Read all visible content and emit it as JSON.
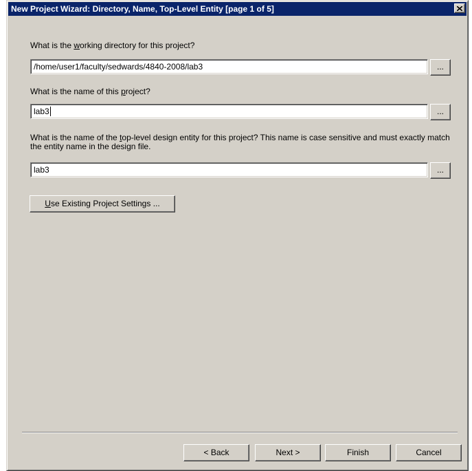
{
  "window": {
    "title": "New Project Wizard: Directory, Name, Top-Level Entity [page 1 of 5]"
  },
  "fields": {
    "working_directory": {
      "label_pre": "What is the ",
      "label_accel": "w",
      "label_post": "orking directory for this project?",
      "value": "/home/user1/faculty/sedwards/4840-2008/lab3",
      "browse_label": "..."
    },
    "project_name": {
      "label_pre": "What is the name of this ",
      "label_accel": "p",
      "label_post": "roject?",
      "value": "lab3",
      "browse_label": "..."
    },
    "top_level_entity": {
      "label_pre": "What is the name of the ",
      "label_accel": "t",
      "label_post": "op-level design entity for this project? This name is case sensitive and must exactly match the entity name in the design file.",
      "value": "lab3",
      "browse_label": "..."
    }
  },
  "use_existing": {
    "accel": "U",
    "rest": "se Existing Project Settings ..."
  },
  "footer": {
    "back_label": "< Back",
    "next_label": "Next >",
    "finish_label": "Finish",
    "cancel_label": "Cancel"
  },
  "icons": {
    "close": "close-icon"
  }
}
